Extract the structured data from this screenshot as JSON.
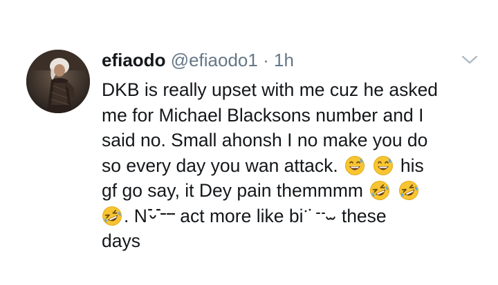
{
  "tweet": {
    "author_name": "efiaodo",
    "handle": "@efiaodo1",
    "separator": "·",
    "time": "1h",
    "lines": [
      "DKB is really upset with me cuz he asked",
      "me for Michael Blacksons number and I",
      "said no. Small ahonsh I no make you do",
      "so every day you wan attack.",
      "his",
      "gf go say, it Dey pain themmmm",
      ". N",
      "act more like bi",
      "these",
      "days"
    ]
  },
  "icons": {
    "avatar": "profile-photo",
    "menu": "chevron-down-icon",
    "emoji_sweat": "grinning-face-with-sweat",
    "emoji_rofl": "rolling-on-floor-laughing"
  },
  "colors": {
    "text": "#14171a",
    "secondary": "#657786",
    "chevron": "#aab8c2",
    "emoji_yellow": "#f7c531"
  }
}
